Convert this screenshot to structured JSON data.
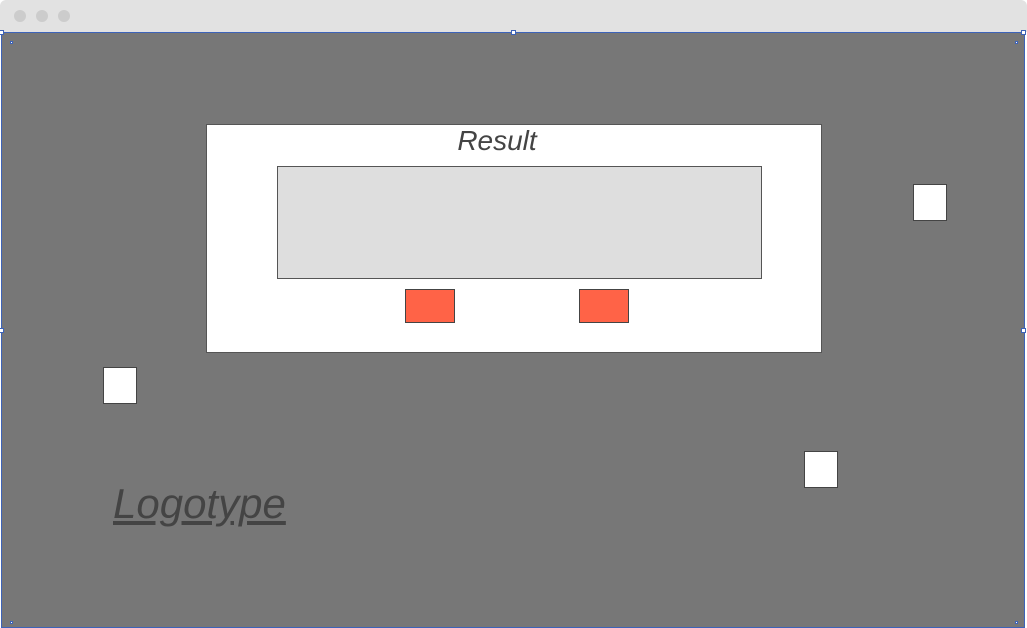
{
  "result_panel": {
    "title": "Result"
  },
  "branding": {
    "logotype": "Logotype"
  },
  "colors": {
    "canvas_background": "#777777",
    "panel_background": "#ffffff",
    "result_box_background": "#dedede",
    "button_color": "#ff6347",
    "selection_outline": "#3d63b8",
    "text_color": "#444444"
  }
}
